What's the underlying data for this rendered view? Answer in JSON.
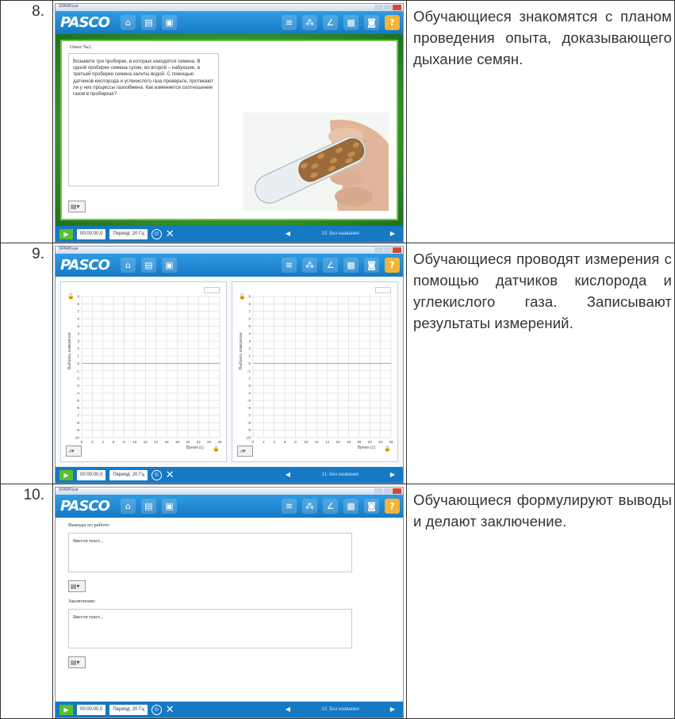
{
  "app": {
    "logo": "PASCO",
    "window_title": "SPARKvue",
    "sample_rate": "Период: 20 Гц",
    "time_display": "00:00:00,0",
    "icons": [
      "home-icon",
      "page-icon",
      "page-icon",
      "wireless-icon",
      "sensors-icon",
      "analysis-icon",
      "journal-icon",
      "camera-icon",
      "help-icon"
    ]
  },
  "rows": [
    {
      "number": "8.",
      "description": "Обучающиеся знакомятся с планом проведения опыта, доказывающего дыхание семян.",
      "page_label": "10: Без названия",
      "experiment_title": "Опыт №2.",
      "experiment_text": "Возьмите три пробирки, в которых находятся семена. В одной пробирке семена сухие, во второй – набухшие, в третьей пробирке семена залиты водой. С помощью датчиков кислорода и углекислого газа проверьте, протекают ли у них процессы газообмена. Как изменяется соотношение газов в пробирках?"
    },
    {
      "number": "9.",
      "description": "Обучающиеся проводят измерения с помощью датчиков кислорода и углекислого газа. Записывают результаты измерений.",
      "page_label": "11: Без названия",
      "y_axis_label": "Выбрать измерение",
      "x_axis_label": "Время (с)",
      "y_ticks": [
        "9",
        "8",
        "7",
        "6",
        "5",
        "4",
        "3",
        "2",
        "1",
        "0",
        "-1",
        "-2",
        "-3",
        "-4",
        "-5",
        "-6",
        "-7",
        "-8",
        "-9",
        "-10"
      ],
      "x_ticks": [
        "0",
        "2",
        "4",
        "6",
        "8",
        "10",
        "12",
        "14",
        "16",
        "18",
        "20",
        "22",
        "24",
        "26"
      ]
    },
    {
      "number": "10.",
      "description": "Обучающиеся формулируют выводы и делают заключение.",
      "page_label": "12: Без названия",
      "findings_label": "Выводы по работе:",
      "findings_placeholder": "Ввести текст...",
      "conclusion_label": "Заключение:",
      "conclusion_placeholder": "Ввести текст..."
    }
  ]
}
